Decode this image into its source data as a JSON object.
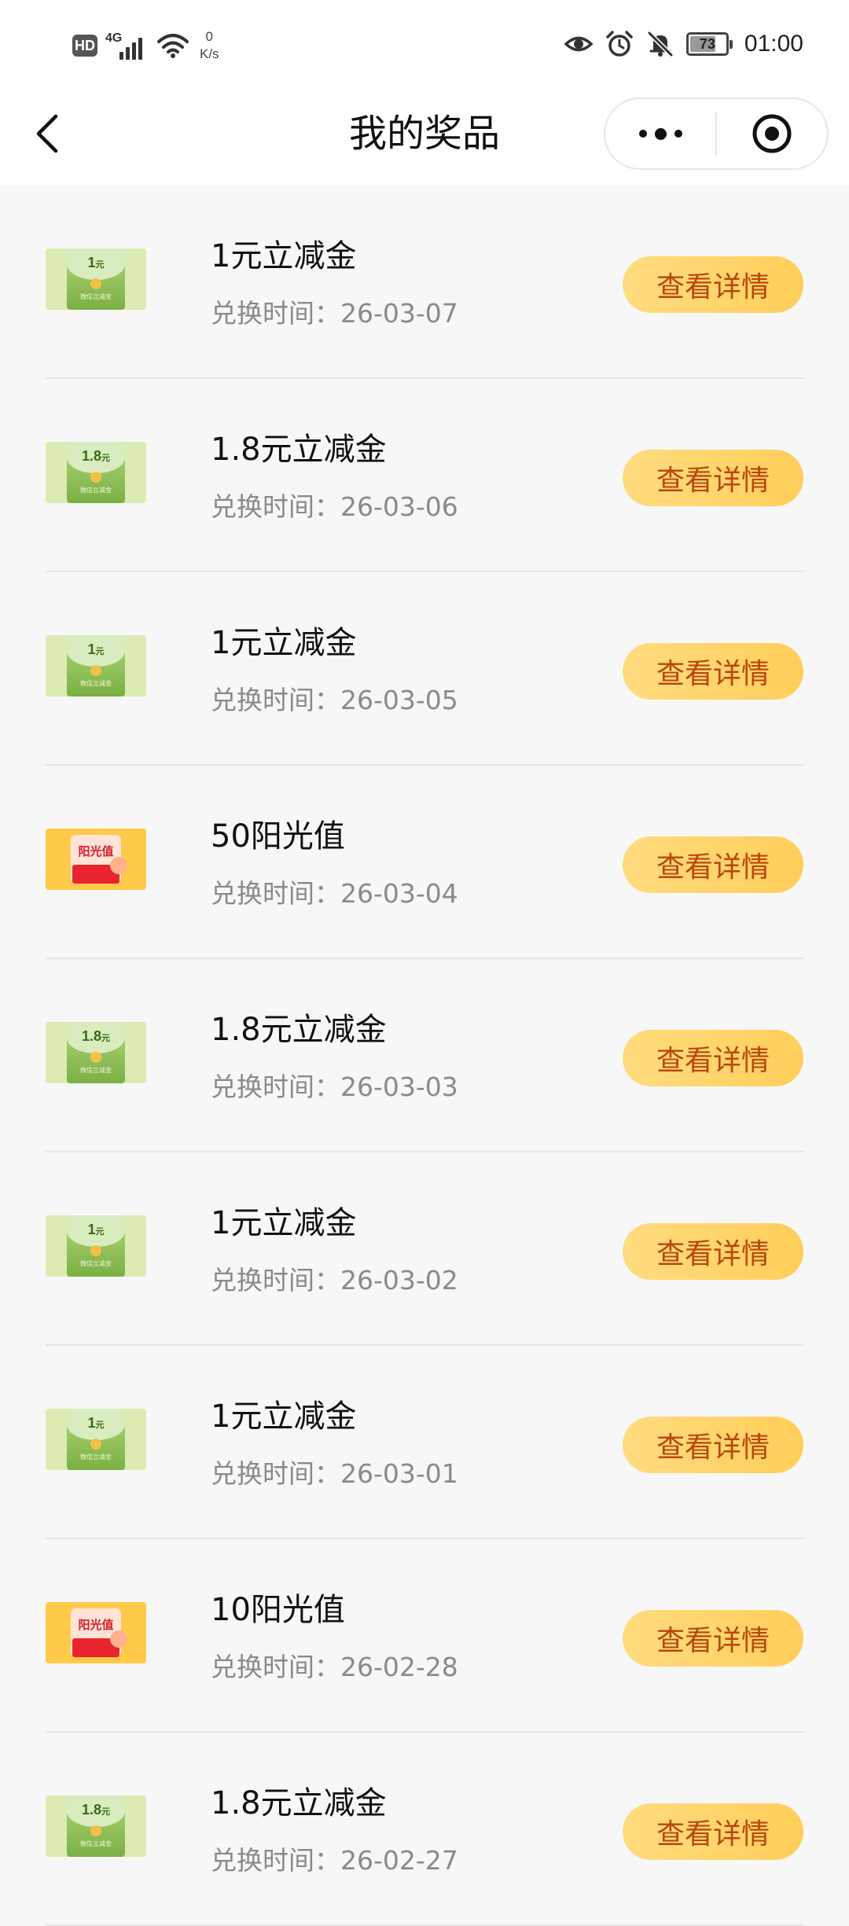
{
  "status_bar": {
    "hd": "HD",
    "network": "4G",
    "speed_value": "0",
    "speed_unit": "K/s",
    "battery": "73",
    "battery_level": 0.73,
    "time": "01:00"
  },
  "nav": {
    "title": "我的奖品"
  },
  "prizes": [
    {
      "name": "1元立减金",
      "time": "兑换时间：26-03-07",
      "button": "查看详情",
      "icon": "wechat-pay-voucher-1",
      "thumb_amount": "1",
      "thumb_unit": "元",
      "thumb_caption": "微信立减金"
    },
    {
      "name": "1.8元立减金",
      "time": "兑换时间：26-03-06",
      "button": "查看详情",
      "icon": "wechat-pay-voucher-1.8",
      "thumb_amount": "1.8",
      "thumb_unit": "元",
      "thumb_caption": "微信立减金"
    },
    {
      "name": "1元立减金",
      "time": "兑换时间：26-03-05",
      "button": "查看详情",
      "icon": "wechat-pay-voucher-1",
      "thumb_amount": "1",
      "thumb_unit": "元",
      "thumb_caption": "微信立减金"
    },
    {
      "name": "50阳光值",
      "time": "兑换时间：26-03-04",
      "button": "查看详情",
      "icon": "sunshine-value-card",
      "thumb_label": "阳光值"
    },
    {
      "name": "1.8元立减金",
      "time": "兑换时间：26-03-03",
      "button": "查看详情",
      "icon": "wechat-pay-voucher-1.8",
      "thumb_amount": "1.8",
      "thumb_unit": "元",
      "thumb_caption": "微信立减金"
    },
    {
      "name": "1元立减金",
      "time": "兑换时间：26-03-02",
      "button": "查看详情",
      "icon": "wechat-pay-voucher-1",
      "thumb_amount": "1",
      "thumb_unit": "元",
      "thumb_caption": "微信立减金"
    },
    {
      "name": "1元立减金",
      "time": "兑换时间：26-03-01",
      "button": "查看详情",
      "icon": "wechat-pay-voucher-1",
      "thumb_amount": "1",
      "thumb_unit": "元",
      "thumb_caption": "微信立减金"
    },
    {
      "name": "10阳光值",
      "time": "兑换时间：26-02-28",
      "button": "查看详情",
      "icon": "sunshine-value-card",
      "thumb_label": "阳光值"
    },
    {
      "name": "1.8元立减金",
      "time": "兑换时间：26-02-27",
      "button": "查看详情",
      "icon": "wechat-pay-voucher-1.8",
      "thumb_amount": "1.8",
      "thumb_unit": "元",
      "thumb_caption": "微信立减金"
    }
  ],
  "colors": {
    "button_bg": "#ffd66e",
    "button_text": "#b8460e",
    "time_text": "#8a8a8a",
    "page_bg": "#f7f7f7"
  }
}
